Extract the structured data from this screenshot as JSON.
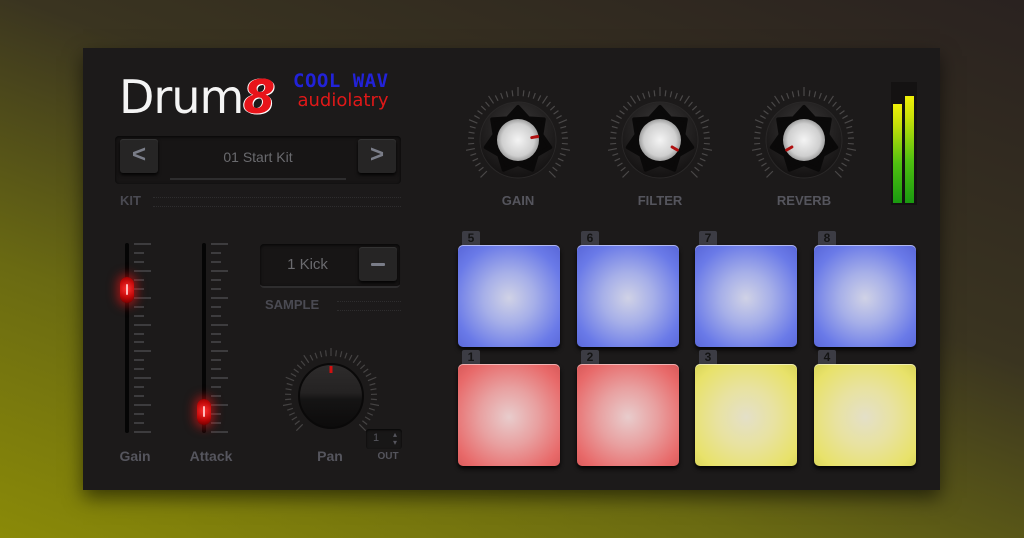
{
  "logo": {
    "drum": "Drum",
    "eight": "8"
  },
  "brand": {
    "line1": "COOL WAV",
    "line2": "audiolatry"
  },
  "kit": {
    "prev_label": "<",
    "next_label": ">",
    "name": "01 Start Kit",
    "section_label": "KIT"
  },
  "sliders": [
    {
      "label": "Gain",
      "value": 0.79
    },
    {
      "label": "Attack",
      "value": 0.05
    }
  ],
  "sample": {
    "name": "1 Kick",
    "section_label": "SAMPLE",
    "remove_icon": "minus-icon"
  },
  "pan": {
    "label": "Pan",
    "value": 0.5
  },
  "output": {
    "value": "1",
    "label": "OUT",
    "arrows": "▲▼"
  },
  "knobs": [
    {
      "label": "GAIN",
      "angle_deg": 80
    },
    {
      "label": "FILTER",
      "angle_deg": 120
    },
    {
      "label": "REVERB",
      "angle_deg": -120
    }
  ],
  "meter": {
    "left_level": 0.83,
    "right_level": 0.9
  },
  "pads": [
    {
      "number": "5",
      "color": "blue"
    },
    {
      "number": "6",
      "color": "blue"
    },
    {
      "number": "7",
      "color": "blue"
    },
    {
      "number": "8",
      "color": "blue"
    },
    {
      "number": "1",
      "color": "red"
    },
    {
      "number": "2",
      "color": "red"
    },
    {
      "number": "3",
      "color": "yellow"
    },
    {
      "number": "4",
      "color": "yellow"
    }
  ],
  "colors": {
    "accent_red": "#e8141a",
    "brand_blue": "#2222d8",
    "pad_blue": "#6a7ae8",
    "pad_red": "#e86a6a",
    "pad_yellow": "#e8e26a"
  }
}
